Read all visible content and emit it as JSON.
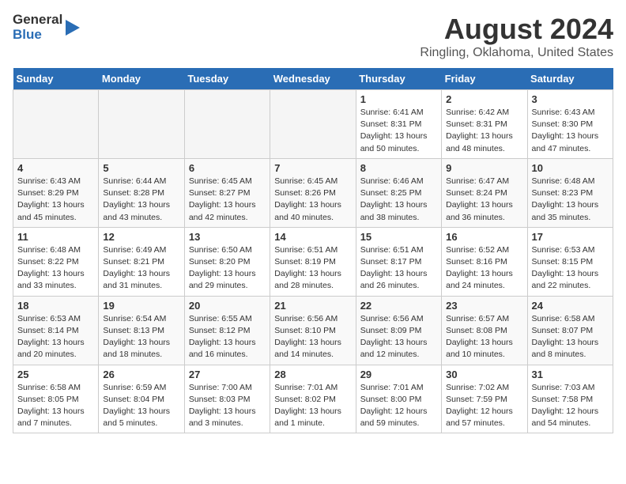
{
  "logo": {
    "general": "General",
    "blue": "Blue"
  },
  "title": "August 2024",
  "subtitle": "Ringling, Oklahoma, United States",
  "days_of_week": [
    "Sunday",
    "Monday",
    "Tuesday",
    "Wednesday",
    "Thursday",
    "Friday",
    "Saturday"
  ],
  "weeks": [
    [
      {
        "day": "",
        "detail": ""
      },
      {
        "day": "",
        "detail": ""
      },
      {
        "day": "",
        "detail": ""
      },
      {
        "day": "",
        "detail": ""
      },
      {
        "day": "1",
        "detail": "Sunrise: 6:41 AM\nSunset: 8:31 PM\nDaylight: 13 hours and 50 minutes."
      },
      {
        "day": "2",
        "detail": "Sunrise: 6:42 AM\nSunset: 8:31 PM\nDaylight: 13 hours and 48 minutes."
      },
      {
        "day": "3",
        "detail": "Sunrise: 6:43 AM\nSunset: 8:30 PM\nDaylight: 13 hours and 47 minutes."
      }
    ],
    [
      {
        "day": "4",
        "detail": "Sunrise: 6:43 AM\nSunset: 8:29 PM\nDaylight: 13 hours and 45 minutes."
      },
      {
        "day": "5",
        "detail": "Sunrise: 6:44 AM\nSunset: 8:28 PM\nDaylight: 13 hours and 43 minutes."
      },
      {
        "day": "6",
        "detail": "Sunrise: 6:45 AM\nSunset: 8:27 PM\nDaylight: 13 hours and 42 minutes."
      },
      {
        "day": "7",
        "detail": "Sunrise: 6:45 AM\nSunset: 8:26 PM\nDaylight: 13 hours and 40 minutes."
      },
      {
        "day": "8",
        "detail": "Sunrise: 6:46 AM\nSunset: 8:25 PM\nDaylight: 13 hours and 38 minutes."
      },
      {
        "day": "9",
        "detail": "Sunrise: 6:47 AM\nSunset: 8:24 PM\nDaylight: 13 hours and 36 minutes."
      },
      {
        "day": "10",
        "detail": "Sunrise: 6:48 AM\nSunset: 8:23 PM\nDaylight: 13 hours and 35 minutes."
      }
    ],
    [
      {
        "day": "11",
        "detail": "Sunrise: 6:48 AM\nSunset: 8:22 PM\nDaylight: 13 hours and 33 minutes."
      },
      {
        "day": "12",
        "detail": "Sunrise: 6:49 AM\nSunset: 8:21 PM\nDaylight: 13 hours and 31 minutes."
      },
      {
        "day": "13",
        "detail": "Sunrise: 6:50 AM\nSunset: 8:20 PM\nDaylight: 13 hours and 29 minutes."
      },
      {
        "day": "14",
        "detail": "Sunrise: 6:51 AM\nSunset: 8:19 PM\nDaylight: 13 hours and 28 minutes."
      },
      {
        "day": "15",
        "detail": "Sunrise: 6:51 AM\nSunset: 8:17 PM\nDaylight: 13 hours and 26 minutes."
      },
      {
        "day": "16",
        "detail": "Sunrise: 6:52 AM\nSunset: 8:16 PM\nDaylight: 13 hours and 24 minutes."
      },
      {
        "day": "17",
        "detail": "Sunrise: 6:53 AM\nSunset: 8:15 PM\nDaylight: 13 hours and 22 minutes."
      }
    ],
    [
      {
        "day": "18",
        "detail": "Sunrise: 6:53 AM\nSunset: 8:14 PM\nDaylight: 13 hours and 20 minutes."
      },
      {
        "day": "19",
        "detail": "Sunrise: 6:54 AM\nSunset: 8:13 PM\nDaylight: 13 hours and 18 minutes."
      },
      {
        "day": "20",
        "detail": "Sunrise: 6:55 AM\nSunset: 8:12 PM\nDaylight: 13 hours and 16 minutes."
      },
      {
        "day": "21",
        "detail": "Sunrise: 6:56 AM\nSunset: 8:10 PM\nDaylight: 13 hours and 14 minutes."
      },
      {
        "day": "22",
        "detail": "Sunrise: 6:56 AM\nSunset: 8:09 PM\nDaylight: 13 hours and 12 minutes."
      },
      {
        "day": "23",
        "detail": "Sunrise: 6:57 AM\nSunset: 8:08 PM\nDaylight: 13 hours and 10 minutes."
      },
      {
        "day": "24",
        "detail": "Sunrise: 6:58 AM\nSunset: 8:07 PM\nDaylight: 13 hours and 8 minutes."
      }
    ],
    [
      {
        "day": "25",
        "detail": "Sunrise: 6:58 AM\nSunset: 8:05 PM\nDaylight: 13 hours and 7 minutes."
      },
      {
        "day": "26",
        "detail": "Sunrise: 6:59 AM\nSunset: 8:04 PM\nDaylight: 13 hours and 5 minutes."
      },
      {
        "day": "27",
        "detail": "Sunrise: 7:00 AM\nSunset: 8:03 PM\nDaylight: 13 hours and 3 minutes."
      },
      {
        "day": "28",
        "detail": "Sunrise: 7:01 AM\nSunset: 8:02 PM\nDaylight: 13 hours and 1 minute."
      },
      {
        "day": "29",
        "detail": "Sunrise: 7:01 AM\nSunset: 8:00 PM\nDaylight: 12 hours and 59 minutes."
      },
      {
        "day": "30",
        "detail": "Sunrise: 7:02 AM\nSunset: 7:59 PM\nDaylight: 12 hours and 57 minutes."
      },
      {
        "day": "31",
        "detail": "Sunrise: 7:03 AM\nSunset: 7:58 PM\nDaylight: 12 hours and 54 minutes."
      }
    ]
  ]
}
